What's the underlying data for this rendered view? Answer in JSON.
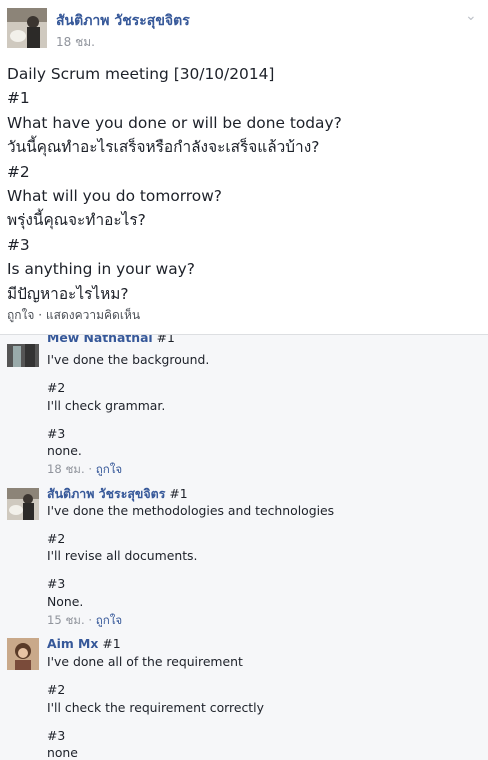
{
  "post": {
    "author": "สันติภาพ วัชระสุขจิตร",
    "time": "18 ชม.",
    "lines": [
      "Daily Scrum meeting [30/10/2014]",
      "#1",
      "What have you done or will be done today?",
      "วันนี้คุณทำอะไรเสร็จหรือกำลังจะเสร็จแล้วบ้าง?",
      "#2",
      "What will you do tomorrow?",
      "พรุ่งนี้คุณจะทำอะไร?",
      "#3",
      "Is anything in your way?",
      "มีปัญหาอะไรไหม?"
    ],
    "actions": {
      "like": "ถูกใจ",
      "separator": "·",
      "comment": "แสดงความคิดเห็น"
    }
  },
  "comments": [
    {
      "author": "Mew Nathathai",
      "tag": "#1",
      "lines": [
        "I've done the background.",
        "#2",
        "I'll check grammar.",
        "#3",
        "none."
      ],
      "time": "18 ชม.",
      "like": "ถูกใจ"
    },
    {
      "author": "สันติภาพ วัชระสุขจิตร",
      "tag": "#1",
      "lines": [
        "I've done the methodologies and technologies",
        "#2",
        "I'll revise all documents.",
        "#3",
        "None."
      ],
      "time": "15 ชม.",
      "like": "ถูกใจ"
    },
    {
      "author": "Aim Mx",
      "tag": "#1",
      "lines": [
        "I've done all of the requirement",
        "#2",
        "I'll check the requirement correctly",
        "#3",
        "none"
      ]
    }
  ],
  "icons": {
    "chevron": "chevron-down-icon"
  },
  "colors": {
    "name": "#365899",
    "meta": "#90949c",
    "comments_bg": "#f6f7f9"
  }
}
